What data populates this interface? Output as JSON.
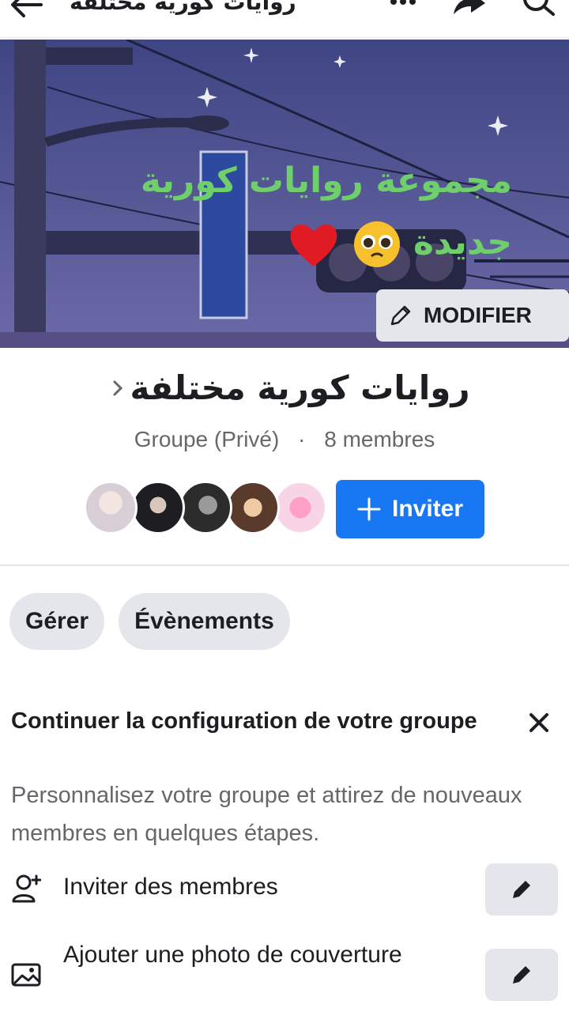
{
  "header": {
    "title": "روايات كورية مختلفة",
    "icons": [
      "back-arrow-icon",
      "more-icon",
      "share-icon",
      "search-icon"
    ]
  },
  "cover": {
    "text_line1": "مجموعة روايات كورية",
    "text_line2": "جديدة",
    "emojis": [
      "pleading-face-emoji",
      "red-heart-emoji"
    ],
    "modify_label": "MODIFIER"
  },
  "group": {
    "name": "روايات كورية مختلفة",
    "privacy": "Groupe (Privé)",
    "separator": "·",
    "members": "8 membres"
  },
  "invite": {
    "label": "Inviter"
  },
  "chips": [
    {
      "label": "Gérer"
    },
    {
      "label": "Évènements"
    }
  ],
  "setup": {
    "title": "Continuer la configuration de votre groupe",
    "description": "Personnalisez votre groupe et attirez de nouveaux membres en quelques étapes.",
    "tasks": [
      {
        "label": "Inviter des membres",
        "icon": "add-person-icon"
      },
      {
        "label": "Ajouter une photo de couverture",
        "icon": "image-icon"
      }
    ]
  },
  "colors": {
    "primary": "#1877f2",
    "chip_bg": "#e4e6eb",
    "cover_text": "#6fcf6a",
    "secondary_text": "#65676b"
  }
}
